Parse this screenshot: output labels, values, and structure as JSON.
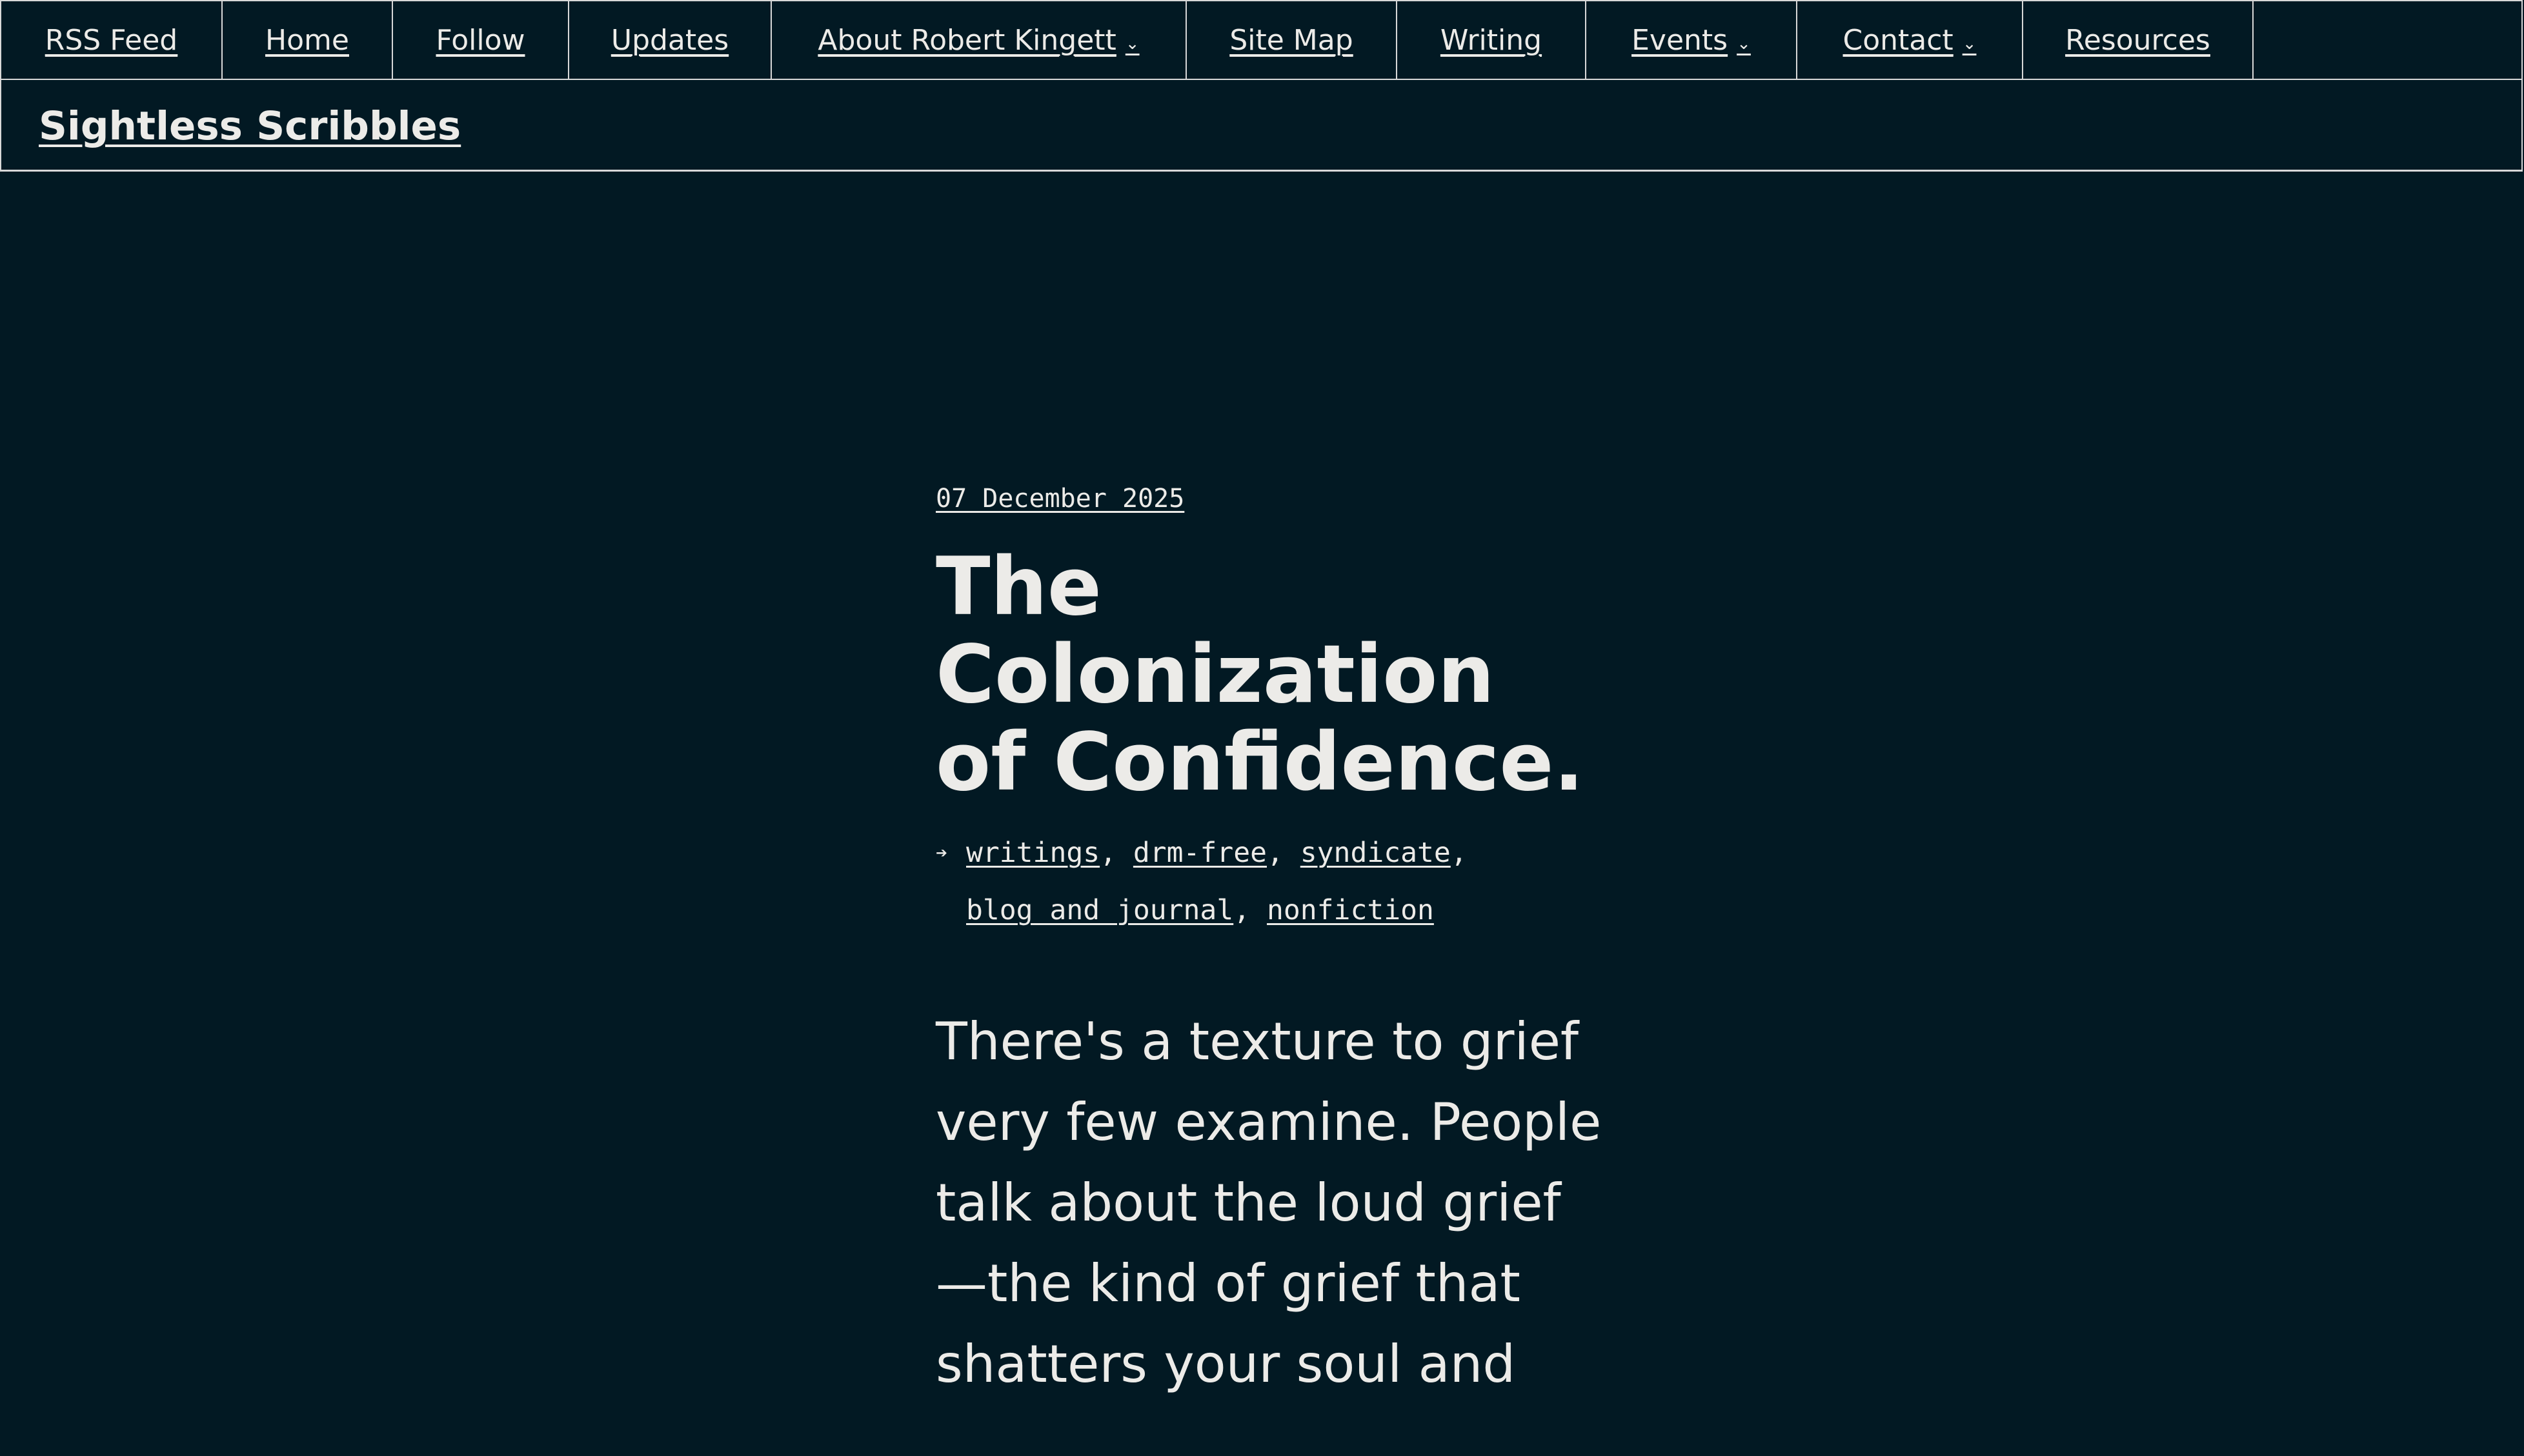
{
  "nav": {
    "items": [
      {
        "label": "RSS Feed",
        "dropdown": false
      },
      {
        "label": "Home",
        "dropdown": false
      },
      {
        "label": "Follow",
        "dropdown": false
      },
      {
        "label": "Updates",
        "dropdown": false
      },
      {
        "label": "About Robert Kingett",
        "dropdown": true
      },
      {
        "label": "Site Map",
        "dropdown": false
      },
      {
        "label": "Writing",
        "dropdown": false
      },
      {
        "label": "Events",
        "dropdown": true
      },
      {
        "label": "Contact",
        "dropdown": true
      },
      {
        "label": "Resources",
        "dropdown": false
      }
    ],
    "caret_glyph": "⌄"
  },
  "site": {
    "title": "Sightless Scribbles"
  },
  "article": {
    "date": "07 December 2025",
    "title": "The Colonization of Confidence.",
    "tag_icon": "tag-icon",
    "tags": [
      "writings",
      "drm-free",
      "syndicate",
      "blog and journal",
      "nonfiction"
    ],
    "body": "There's a texture to grief very few examine. People talk about the loud grief —the kind of grief that shatters your soul and"
  },
  "colors": {
    "background": "#021923",
    "text": "#ECEBE8",
    "border": "#D8D8D8"
  }
}
